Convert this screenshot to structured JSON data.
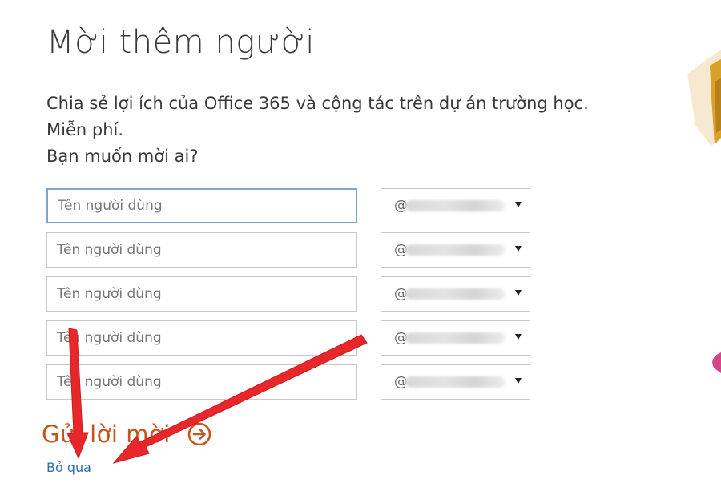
{
  "page": {
    "title": "Mời thêm người",
    "description_lines": [
      "Chia sẻ lợi ích của Office 365 và cộng tác trên dự án trường học.",
      "Miễn phí.",
      "Bạn muốn mời ai?"
    ]
  },
  "invite_rows": [
    {
      "name_placeholder": "Tên người dùng",
      "domain_prefix": "@"
    },
    {
      "name_placeholder": "Tên người dùng",
      "domain_prefix": "@"
    },
    {
      "name_placeholder": "Tên người dùng",
      "domain_prefix": "@"
    },
    {
      "name_placeholder": "Tên người dùng",
      "domain_prefix": "@"
    },
    {
      "name_placeholder": "Tên người dùng",
      "domain_prefix": "@"
    }
  ],
  "actions": {
    "send_label": "Gửi lời mời",
    "skip_label": "Bỏ qua"
  },
  "colors": {
    "accent_orange": "#c5541d",
    "link_blue": "#2c6ea7",
    "annotation_red": "#e8272b",
    "focus_border": "#7fa6c9"
  },
  "icons": {
    "send": "arrow-circle-right-icon",
    "dropdown": "caret-down-icon"
  }
}
